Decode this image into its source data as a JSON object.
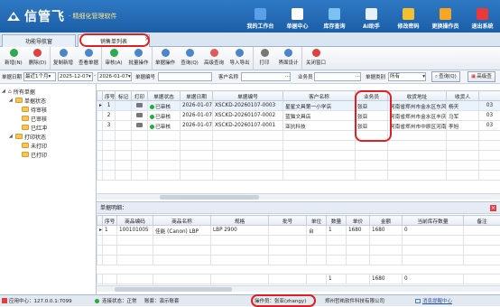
{
  "app": {
    "name": "信管飞",
    "subtitle": "· 精细化管理软件"
  },
  "topnav": [
    {
      "label": "我的工作台",
      "icon": "workbench-icon",
      "color": "#5aa0e6"
    },
    {
      "label": "单据中心",
      "icon": "document-center-icon",
      "color": "#ffffff"
    },
    {
      "label": "库存查询",
      "icon": "inventory-icon",
      "color": "#7cc1f0"
    },
    {
      "label": "AI助手",
      "icon": "ai-assistant-icon",
      "color": "#e8f0fa"
    },
    {
      "label": "修改密码",
      "icon": "lock-icon",
      "color": "#f3c030"
    },
    {
      "label": "更换操作员",
      "icon": "user-switch-icon",
      "color": "#f5a623"
    },
    {
      "label": "退出系统",
      "icon": "exit-icon",
      "color": "#e83a3a"
    }
  ],
  "tabs": [
    {
      "label": "功能导航窗"
    },
    {
      "label": "销售单列表",
      "close": "×"
    }
  ],
  "toolbar": [
    {
      "label": "新增(N)",
      "icon": "add-icon",
      "color": "#2fa84f"
    },
    {
      "label": "删除(D)",
      "icon": "delete-icon",
      "color": "#e04040"
    },
    {
      "label": "复制新增",
      "icon": "copy-icon",
      "color": "#4a86c8"
    },
    {
      "label": "查看单据",
      "icon": "view-document-icon",
      "color": "#4a86c8"
    },
    {
      "label": "审核(A)",
      "icon": "approve-icon",
      "color": "#2fa84f"
    },
    {
      "label": "批量操作",
      "icon": "batch-icon",
      "color": "#4a86c8"
    },
    {
      "label": "单据操作",
      "icon": "document-action-icon",
      "color": "#4a86c8"
    },
    {
      "label": "查询(Q)",
      "icon": "query-icon",
      "color": "#4a86c8"
    },
    {
      "label": "高级查询",
      "icon": "advanced-query-icon",
      "color": "#e05b5b"
    },
    {
      "label": "导入导出",
      "icon": "import-export-icon",
      "color": "#4a86c8"
    },
    {
      "label": "打印",
      "icon": "print-icon",
      "color": "#777777"
    },
    {
      "label": "界面设计",
      "icon": "layout-design-icon",
      "color": "#4a86c8"
    },
    {
      "label": "关闭窗口",
      "icon": "close-window-icon",
      "color": "#e04040"
    }
  ],
  "filter": {
    "date_label": "单据日期",
    "period": "最近1个月",
    "date_from": "2025-12-07",
    "date_to": "2026-01-07",
    "code_label": "单据编号",
    "customer_label": "客户名称",
    "salesperson_label": "业务员",
    "type_label": "单据类别",
    "type_value": "所有",
    "query_btn": "查询(Q)",
    "adv_btn": "高级查"
  },
  "tree": {
    "root": "所有单据",
    "groups": [
      {
        "label": "单据状态",
        "children": [
          "待审核",
          "已审核",
          "已红冲"
        ]
      },
      {
        "label": "打印状态",
        "children": [
          "未打印",
          "已打印"
        ]
      }
    ]
  },
  "main_table": {
    "columns": [
      "序号",
      "标记",
      "打印",
      "单据状态",
      "单据日期",
      "单据编号",
      "客户名称",
      "业务员",
      "收货地址",
      "收货人",
      ""
    ],
    "rows": [
      {
        "no": "1",
        "status": "已审核",
        "date": "2026-01-07",
        "code": "XSCKD-20260107-0003",
        "customer": "星星文具第一小学店",
        "salesperson": "张亚",
        "address": "河南省郑州市金水区东风",
        "receiver": "杨天",
        "extra": "03"
      },
      {
        "no": "2",
        "status": "已审核",
        "date": "2026-01-07",
        "code": "XSCKD-20260107-0002",
        "customer": "蓝猫文具店",
        "salesperson": "张亚",
        "address": "河南省郑州市金水区丰庆",
        "receiver": "马军",
        "extra": "03"
      },
      {
        "no": "3",
        "status": "已审核",
        "date": "2026-01-07",
        "code": "XSCKD-20260107-0001",
        "customer": "亚抗科技",
        "salesperson": "张亚",
        "address": "河南省郑州市中原区河南",
        "receiver": "李旭",
        "extra": "03"
      }
    ]
  },
  "detail": {
    "title": "单据明细：",
    "columns": [
      "序号",
      "商品编码",
      "商品名称",
      "规格",
      "批号",
      "单位",
      "数量",
      "单价",
      "金额",
      "当前库存数量",
      "备注"
    ],
    "rows": [
      {
        "no": "1",
        "code": "100101005",
        "name": "佳能 (Canon) LBP",
        "spec": "LBP 2900",
        "batch": "",
        "unit": "台",
        "qty": "1",
        "price": "1680",
        "amount": "1680",
        "stock": "0",
        "note": ""
      }
    ],
    "totals": {
      "qty": "1",
      "amount": "1680",
      "stock": "0"
    }
  },
  "status": {
    "center": "应用中心：127.0.0.1:7099",
    "connection": "连接状态：正常",
    "account": "账套：演示账套",
    "operator": "操作员：张亚(zhangy)",
    "company": "郑州哲祐软件科技有限公司",
    "msg": "消息提醒中心"
  }
}
